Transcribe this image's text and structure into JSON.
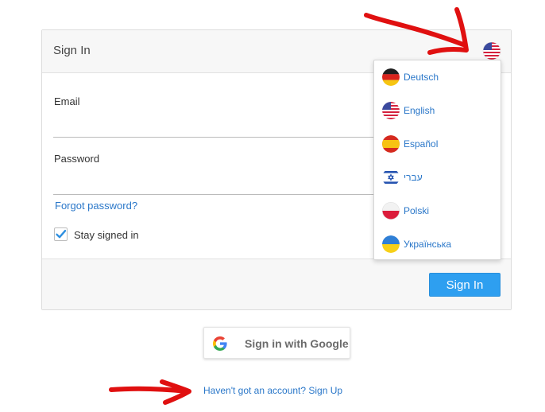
{
  "card": {
    "title": "Sign In",
    "language_toggle_icon": "us-flag-icon",
    "email_label": "Email",
    "email_value": "",
    "password_label": "Password",
    "password_value": "",
    "forgot_link": "Forgot password?",
    "stay_signed_in_label": "Stay signed in",
    "stay_signed_in_checked": true,
    "signin_button": "Sign In"
  },
  "language_menu": {
    "items": [
      {
        "label": "Deutsch",
        "icon": "germany-flag-icon"
      },
      {
        "label": "English",
        "icon": "us-flag-icon"
      },
      {
        "label": "Español",
        "icon": "spain-flag-icon"
      },
      {
        "label": "עברי",
        "icon": "israel-flag-icon"
      },
      {
        "label": "Polski",
        "icon": "poland-flag-icon"
      },
      {
        "label": "Українська",
        "icon": "ukraine-flag-icon"
      }
    ]
  },
  "google_button": {
    "label": "Sign in with Google",
    "icon": "google-g-icon"
  },
  "signup_link": "Haven't got an account? Sign Up",
  "colors": {
    "link": "#2a77c9",
    "primary_button": "#2e9ff0",
    "annotation_arrow": "#e01010",
    "header_bg": "#f7f7f7"
  }
}
